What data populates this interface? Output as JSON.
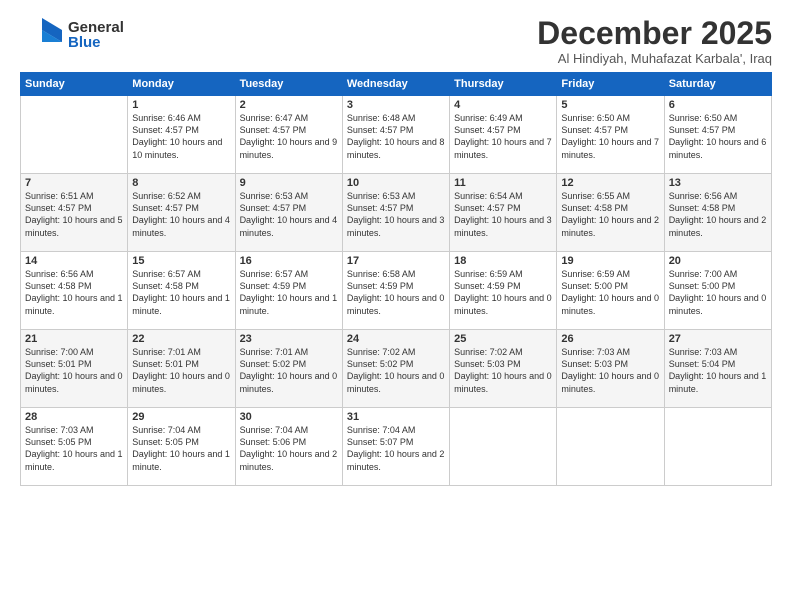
{
  "header": {
    "logo_general": "General",
    "logo_blue": "Blue",
    "title": "December 2025",
    "location": "Al Hindiyah, Muhafazat Karbala', Iraq"
  },
  "days_of_week": [
    "Sunday",
    "Monday",
    "Tuesday",
    "Wednesday",
    "Thursday",
    "Friday",
    "Saturday"
  ],
  "weeks": [
    [
      {
        "day": "",
        "sunrise": "",
        "sunset": "",
        "daylight": ""
      },
      {
        "day": "1",
        "sunrise": "Sunrise: 6:46 AM",
        "sunset": "Sunset: 4:57 PM",
        "daylight": "Daylight: 10 hours and 10 minutes."
      },
      {
        "day": "2",
        "sunrise": "Sunrise: 6:47 AM",
        "sunset": "Sunset: 4:57 PM",
        "daylight": "Daylight: 10 hours and 9 minutes."
      },
      {
        "day": "3",
        "sunrise": "Sunrise: 6:48 AM",
        "sunset": "Sunset: 4:57 PM",
        "daylight": "Daylight: 10 hours and 8 minutes."
      },
      {
        "day": "4",
        "sunrise": "Sunrise: 6:49 AM",
        "sunset": "Sunset: 4:57 PM",
        "daylight": "Daylight: 10 hours and 7 minutes."
      },
      {
        "day": "5",
        "sunrise": "Sunrise: 6:50 AM",
        "sunset": "Sunset: 4:57 PM",
        "daylight": "Daylight: 10 hours and 7 minutes."
      },
      {
        "day": "6",
        "sunrise": "Sunrise: 6:50 AM",
        "sunset": "Sunset: 4:57 PM",
        "daylight": "Daylight: 10 hours and 6 minutes."
      }
    ],
    [
      {
        "day": "7",
        "sunrise": "Sunrise: 6:51 AM",
        "sunset": "Sunset: 4:57 PM",
        "daylight": "Daylight: 10 hours and 5 minutes."
      },
      {
        "day": "8",
        "sunrise": "Sunrise: 6:52 AM",
        "sunset": "Sunset: 4:57 PM",
        "daylight": "Daylight: 10 hours and 4 minutes."
      },
      {
        "day": "9",
        "sunrise": "Sunrise: 6:53 AM",
        "sunset": "Sunset: 4:57 PM",
        "daylight": "Daylight: 10 hours and 4 minutes."
      },
      {
        "day": "10",
        "sunrise": "Sunrise: 6:53 AM",
        "sunset": "Sunset: 4:57 PM",
        "daylight": "Daylight: 10 hours and 3 minutes."
      },
      {
        "day": "11",
        "sunrise": "Sunrise: 6:54 AM",
        "sunset": "Sunset: 4:57 PM",
        "daylight": "Daylight: 10 hours and 3 minutes."
      },
      {
        "day": "12",
        "sunrise": "Sunrise: 6:55 AM",
        "sunset": "Sunset: 4:58 PM",
        "daylight": "Daylight: 10 hours and 2 minutes."
      },
      {
        "day": "13",
        "sunrise": "Sunrise: 6:56 AM",
        "sunset": "Sunset: 4:58 PM",
        "daylight": "Daylight: 10 hours and 2 minutes."
      }
    ],
    [
      {
        "day": "14",
        "sunrise": "Sunrise: 6:56 AM",
        "sunset": "Sunset: 4:58 PM",
        "daylight": "Daylight: 10 hours and 1 minute."
      },
      {
        "day": "15",
        "sunrise": "Sunrise: 6:57 AM",
        "sunset": "Sunset: 4:58 PM",
        "daylight": "Daylight: 10 hours and 1 minute."
      },
      {
        "day": "16",
        "sunrise": "Sunrise: 6:57 AM",
        "sunset": "Sunset: 4:59 PM",
        "daylight": "Daylight: 10 hours and 1 minute."
      },
      {
        "day": "17",
        "sunrise": "Sunrise: 6:58 AM",
        "sunset": "Sunset: 4:59 PM",
        "daylight": "Daylight: 10 hours and 0 minutes."
      },
      {
        "day": "18",
        "sunrise": "Sunrise: 6:59 AM",
        "sunset": "Sunset: 4:59 PM",
        "daylight": "Daylight: 10 hours and 0 minutes."
      },
      {
        "day": "19",
        "sunrise": "Sunrise: 6:59 AM",
        "sunset": "Sunset: 5:00 PM",
        "daylight": "Daylight: 10 hours and 0 minutes."
      },
      {
        "day": "20",
        "sunrise": "Sunrise: 7:00 AM",
        "sunset": "Sunset: 5:00 PM",
        "daylight": "Daylight: 10 hours and 0 minutes."
      }
    ],
    [
      {
        "day": "21",
        "sunrise": "Sunrise: 7:00 AM",
        "sunset": "Sunset: 5:01 PM",
        "daylight": "Daylight: 10 hours and 0 minutes."
      },
      {
        "day": "22",
        "sunrise": "Sunrise: 7:01 AM",
        "sunset": "Sunset: 5:01 PM",
        "daylight": "Daylight: 10 hours and 0 minutes."
      },
      {
        "day": "23",
        "sunrise": "Sunrise: 7:01 AM",
        "sunset": "Sunset: 5:02 PM",
        "daylight": "Daylight: 10 hours and 0 minutes."
      },
      {
        "day": "24",
        "sunrise": "Sunrise: 7:02 AM",
        "sunset": "Sunset: 5:02 PM",
        "daylight": "Daylight: 10 hours and 0 minutes."
      },
      {
        "day": "25",
        "sunrise": "Sunrise: 7:02 AM",
        "sunset": "Sunset: 5:03 PM",
        "daylight": "Daylight: 10 hours and 0 minutes."
      },
      {
        "day": "26",
        "sunrise": "Sunrise: 7:03 AM",
        "sunset": "Sunset: 5:03 PM",
        "daylight": "Daylight: 10 hours and 0 minutes."
      },
      {
        "day": "27",
        "sunrise": "Sunrise: 7:03 AM",
        "sunset": "Sunset: 5:04 PM",
        "daylight": "Daylight: 10 hours and 1 minute."
      }
    ],
    [
      {
        "day": "28",
        "sunrise": "Sunrise: 7:03 AM",
        "sunset": "Sunset: 5:05 PM",
        "daylight": "Daylight: 10 hours and 1 minute."
      },
      {
        "day": "29",
        "sunrise": "Sunrise: 7:04 AM",
        "sunset": "Sunset: 5:05 PM",
        "daylight": "Daylight: 10 hours and 1 minute."
      },
      {
        "day": "30",
        "sunrise": "Sunrise: 7:04 AM",
        "sunset": "Sunset: 5:06 PM",
        "daylight": "Daylight: 10 hours and 2 minutes."
      },
      {
        "day": "31",
        "sunrise": "Sunrise: 7:04 AM",
        "sunset": "Sunset: 5:07 PM",
        "daylight": "Daylight: 10 hours and 2 minutes."
      },
      {
        "day": "",
        "sunrise": "",
        "sunset": "",
        "daylight": ""
      },
      {
        "day": "",
        "sunrise": "",
        "sunset": "",
        "daylight": ""
      },
      {
        "day": "",
        "sunrise": "",
        "sunset": "",
        "daylight": ""
      }
    ]
  ]
}
